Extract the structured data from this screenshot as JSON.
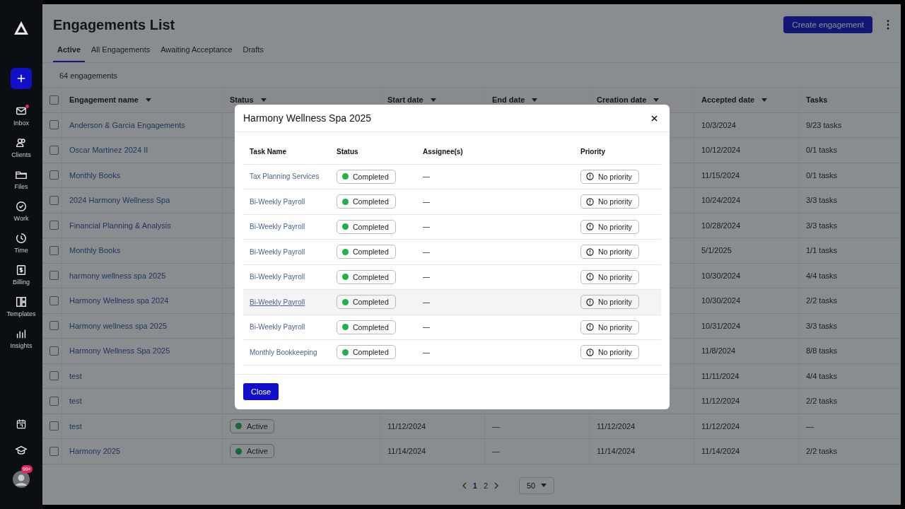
{
  "sidebar": {
    "items": [
      {
        "label": "Inbox",
        "kind": "mail",
        "badge": true
      },
      {
        "label": "Clients",
        "kind": "people",
        "badge": false
      },
      {
        "label": "Files",
        "kind": "folder",
        "badge": false
      },
      {
        "label": "Work",
        "kind": "check",
        "badge": false
      },
      {
        "label": "Time",
        "kind": "clock",
        "badge": false
      },
      {
        "label": "Billing",
        "kind": "dollar",
        "badge": false
      },
      {
        "label": "Templates",
        "kind": "layout",
        "badge": false
      },
      {
        "label": "Insights",
        "kind": "bars",
        "badge": false
      }
    ],
    "bottom": {
      "avatar_badge": "99+"
    }
  },
  "page": {
    "title": "Engagements List",
    "create_button": "Create engagement"
  },
  "tabs": [
    {
      "label": "Active",
      "selected": true
    },
    {
      "label": "All Engagements",
      "selected": false
    },
    {
      "label": "Awaiting Acceptance",
      "selected": false
    },
    {
      "label": "Drafts",
      "selected": false
    }
  ],
  "count": "64 engagements",
  "table": {
    "select_all_checked": false,
    "columns": [
      "Engagement name",
      "Status",
      "Start date",
      "End date",
      "Creation date",
      "Accepted date",
      "Tasks"
    ],
    "rows": [
      {
        "checked": false,
        "name": "Anderson & Garcia Engagements",
        "accepted": "10/3/2024",
        "tasks": "9/23 tasks"
      },
      {
        "checked": false,
        "name": "Oscar Martinez 2024 II",
        "accepted": "10/12/2024",
        "tasks": "0/1 tasks"
      },
      {
        "checked": false,
        "name": "Monthly Books",
        "accepted": "11/15/2024",
        "tasks": "0/1 tasks"
      },
      {
        "checked": false,
        "name": "2024 Harmony Wellness Spa",
        "accepted": "10/24/2024",
        "tasks": "3/3 tasks"
      },
      {
        "checked": false,
        "name": "Financial Planning & Analysis",
        "accepted": "10/28/2024",
        "tasks": "3/3 tasks"
      },
      {
        "checked": false,
        "name": "Monthly Books",
        "accepted": "5/1/2025",
        "tasks": "1/1 tasks"
      },
      {
        "checked": false,
        "name": "harmony wellness spa 2025",
        "accepted": "10/30/2024",
        "tasks": "4/4 tasks"
      },
      {
        "checked": false,
        "name": "Harmony Wellness spa 2024",
        "accepted": "10/30/2024",
        "tasks": "2/2 tasks"
      },
      {
        "checked": false,
        "name": "Harmony wellness spa 2025",
        "accepted": "10/31/2024",
        "tasks": "3/3 tasks"
      },
      {
        "checked": false,
        "name": "Harmony Wellness Spa 2025",
        "accepted": "11/8/2024",
        "tasks": "8/8 tasks"
      },
      {
        "checked": false,
        "name": "test",
        "accepted": "11/11/2024",
        "tasks": "4/4 tasks"
      },
      {
        "checked": false,
        "name": "test",
        "accepted": "11/12/2024",
        "tasks": "2/2 tasks"
      },
      {
        "checked": false,
        "name": "test",
        "status": "Active",
        "start": "11/12/2024",
        "end": "—",
        "created": "11/12/2024",
        "accepted": "11/12/2024",
        "tasks": "—"
      },
      {
        "checked": false,
        "name": "Harmony 2025",
        "status": "Active",
        "start": "11/14/2024",
        "end": "—",
        "created": "11/14/2024",
        "accepted": "11/14/2024",
        "tasks": "2/2 tasks"
      }
    ]
  },
  "pagination": {
    "pages": [
      {
        "label": "1",
        "selected": true
      },
      {
        "label": "2",
        "selected": false
      }
    ],
    "page_size": "50"
  },
  "modal": {
    "title": "Harmony Wellness Spa 2025",
    "columns": [
      "Task Name",
      "Status",
      "Assignee(s)",
      "Priority"
    ],
    "rows": [
      {
        "task": "Tax Planning Services",
        "status": "Completed",
        "assignee": "—",
        "priority": "No priority",
        "hovered": false
      },
      {
        "task": "Bi-Weekly Payroll",
        "status": "Completed",
        "assignee": "—",
        "priority": "No priority",
        "hovered": false
      },
      {
        "task": "Bi-Weekly Payroll",
        "status": "Completed",
        "assignee": "—",
        "priority": "No priority",
        "hovered": false
      },
      {
        "task": "Bi-Weekly Payroll",
        "status": "Completed",
        "assignee": "—",
        "priority": "No priority",
        "hovered": false
      },
      {
        "task": "Bi-Weekly Payroll",
        "status": "Completed",
        "assignee": "—",
        "priority": "No priority",
        "hovered": false
      },
      {
        "task": "Bi-Weekly Payroll",
        "status": "Completed",
        "assignee": "—",
        "priority": "No priority",
        "hovered": true
      },
      {
        "task": "Bi-Weekly Payroll",
        "status": "Completed",
        "assignee": "—",
        "priority": "No priority",
        "hovered": false
      },
      {
        "task": "Monthly Bookkeeping",
        "status": "Completed",
        "assignee": "—",
        "priority": "No priority",
        "hovered": false
      }
    ],
    "close_button": "Close"
  }
}
